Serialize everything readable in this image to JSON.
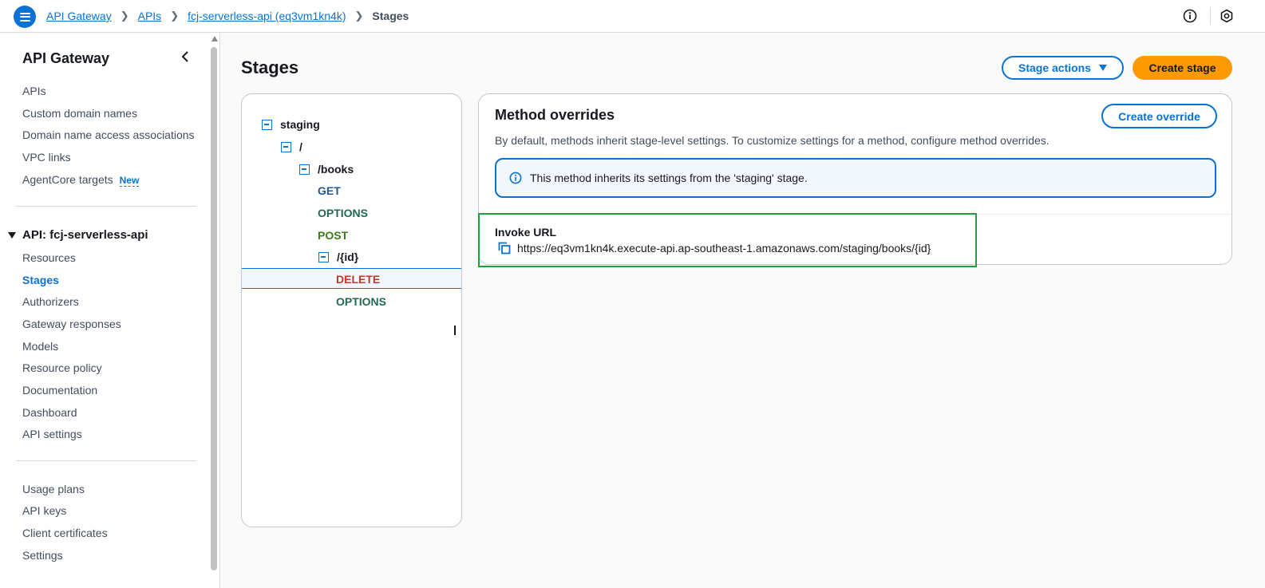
{
  "breadcrumb": {
    "items": [
      "API Gateway",
      "APIs",
      "fcj-serverless-api (eq3vm1kn4k)"
    ],
    "current": "Stages"
  },
  "sidebar": {
    "title": "API Gateway",
    "top_items": [
      "APIs",
      "Custom domain names",
      "Domain name access associations",
      "VPC links",
      "AgentCore targets"
    ],
    "new_badge": "New",
    "api_section": "API: fcj-serverless-api",
    "api_items": [
      "Resources",
      "Stages",
      "Authorizers",
      "Gateway responses",
      "Models",
      "Resource policy",
      "Documentation",
      "Dashboard",
      "API settings"
    ],
    "active_item": "Stages",
    "bottom_items": [
      "Usage plans",
      "API keys",
      "Client certificates",
      "Settings"
    ]
  },
  "main": {
    "title": "Stages",
    "stage_actions_label": "Stage actions",
    "create_stage_label": "Create stage"
  },
  "tree": {
    "stage": "staging",
    "root": "/",
    "books": "/books",
    "books_methods": [
      "GET",
      "OPTIONS",
      "POST"
    ],
    "id": "/{id}",
    "id_methods": [
      "DELETE",
      "OPTIONS"
    ],
    "selected": "DELETE"
  },
  "overrides": {
    "title": "Method overrides",
    "create_override_label": "Create override",
    "description": "By default, methods inherit stage-level settings. To customize settings for a method, configure method overrides.",
    "info_text": "This method inherits its settings from the 'staging' stage.",
    "invoke_label": "Invoke URL",
    "invoke_url": "https://eq3vm1kn4k.execute-api.ap-southeast-1.amazonaws.com/staging/books/{id}"
  },
  "colors": {
    "primary_blue": "#0972d3",
    "orange": "#ff9900",
    "highlight_green": "#1aa13a",
    "delete_red": "#c0392b"
  }
}
